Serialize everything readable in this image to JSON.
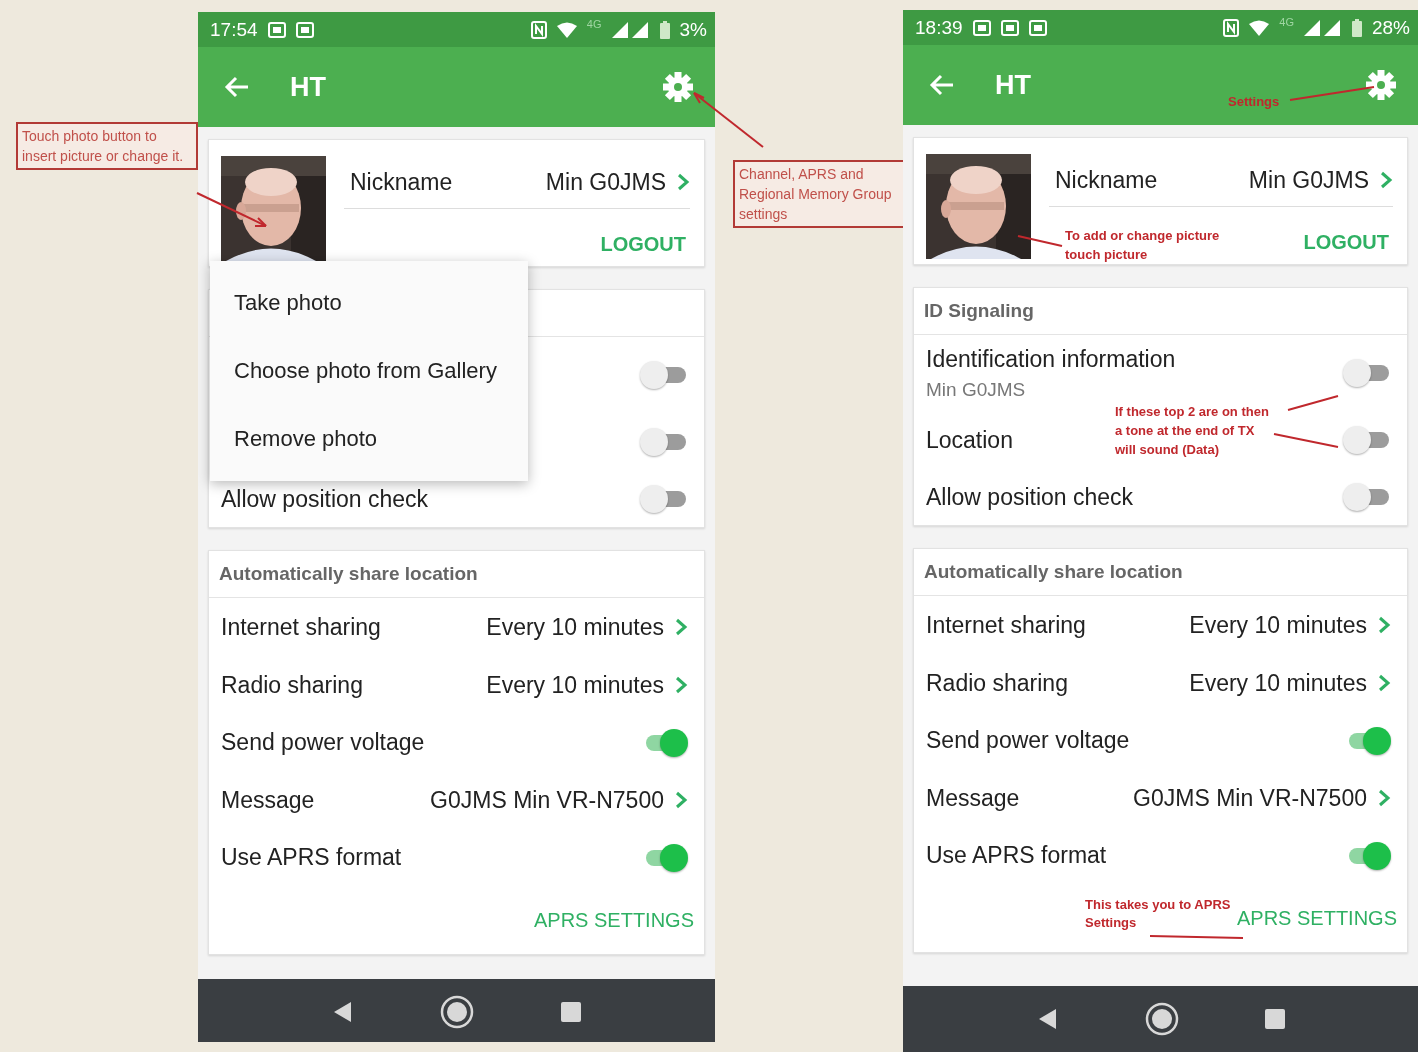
{
  "annotations": [
    {
      "text": "Touch photo button to insert picture or change it."
    },
    {
      "kind": "settings",
      "text": "Channel, APRS and Regional Memory Group settings"
    }
  ],
  "phones": [
    {
      "status_bar": {
        "time": "17:54",
        "network": "4G",
        "battery": "3%"
      },
      "app_bar": {
        "title": "HT"
      },
      "profile": {
        "nickname_label": "Nickname",
        "nickname_value": "Min G0JMS",
        "logout": "LOGOUT"
      },
      "menu": [
        "Take photo",
        "Choose photo from Gallery",
        "Remove photo"
      ],
      "id_section": {
        "rows": [
          {
            "kind": "toggle",
            "on": false
          },
          {
            "kind": "toggle",
            "on": false
          },
          {
            "kind": "toggle",
            "label": "Allow position check",
            "on": false
          }
        ]
      },
      "share_section": {
        "title": "Automatically share location",
        "rows": [
          {
            "kind": "link",
            "label": "Internet sharing",
            "value": "Every 10 minutes"
          },
          {
            "kind": "link",
            "label": "Radio sharing",
            "value": "Every 10 minutes"
          },
          {
            "kind": "toggle",
            "label": "Send power voltage",
            "on": true
          },
          {
            "kind": "link",
            "label": "Message",
            "value": "G0JMS Min VR-N7500"
          },
          {
            "kind": "toggle",
            "label": "Use APRS format",
            "on": true
          }
        ]
      },
      "aprs_button": "APRS SETTINGS"
    },
    {
      "status_bar": {
        "time": "18:39",
        "network": "4G",
        "battery": "28%"
      },
      "app_bar": {
        "title": "HT"
      },
      "profile": {
        "nickname_label": "Nickname",
        "nickname_value": "Min G0JMS",
        "logout": "LOGOUT"
      },
      "id_section": {
        "title": "ID Signaling",
        "rows": [
          {
            "kind": "toggle",
            "label": "Identification information",
            "sublabel": "Min G0JMS",
            "on": false
          },
          {
            "kind": "toggle",
            "label": "Location",
            "on": false
          },
          {
            "kind": "toggle",
            "label": "Allow position check",
            "on": false
          }
        ]
      },
      "share_section": {
        "title": "Automatically share location",
        "rows": [
          {
            "kind": "link",
            "label": "Internet sharing",
            "value": "Every 10 minutes"
          },
          {
            "kind": "link",
            "label": "Radio sharing",
            "value": "Every 10 minutes"
          },
          {
            "kind": "toggle",
            "label": "Send power voltage",
            "on": true
          },
          {
            "kind": "link",
            "label": "Message",
            "value": "G0JMS Min VR-N7500"
          },
          {
            "kind": "toggle",
            "label": "Use APRS format",
            "on": true
          }
        ]
      },
      "aprs_button": "APRS SETTINGS",
      "annotations": [
        {
          "kind": "settings",
          "text": "Settings"
        },
        {
          "kind": "picture",
          "text": "To add or change picture touch picture"
        },
        {
          "kind": "toggles",
          "text": "If these top 2 are on then a tone at the end of TX will sound (Data)"
        },
        {
          "kind": "aprs",
          "text": "This takes you to APRS Settings"
        }
      ]
    }
  ]
}
